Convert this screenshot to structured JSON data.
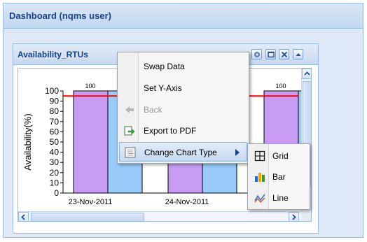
{
  "dashboard": {
    "title": "Dashboard (nqms user)"
  },
  "portlet": {
    "title": "Availability_RTUs",
    "tools": [
      "gear-icon",
      "maximize-icon",
      "close-icon",
      "collapse-icon"
    ]
  },
  "chart_data": {
    "type": "bar",
    "ylabel": "Availability(%)",
    "ylim": [
      0,
      100
    ],
    "yticks": [
      "0",
      "10",
      "20",
      "30",
      "40",
      "50",
      "60",
      "70",
      "80",
      "90",
      "100"
    ],
    "categories": [
      "23-Nov-2011",
      "24-Nov-2011"
    ],
    "visible_data_labels": [
      "100",
      "100"
    ],
    "threshold_line": 95,
    "series_colors": [
      "#c79cf2",
      "#99ccfa"
    ],
    "grid": false,
    "legend": "none"
  },
  "context_menu": {
    "items": [
      {
        "label": "Swap Data",
        "enabled": true,
        "icon": ""
      },
      {
        "label": "Set Y-Axis",
        "enabled": true,
        "icon": ""
      },
      {
        "label": "Back",
        "enabled": false,
        "icon": "back-arrow-icon"
      },
      {
        "label": "Export to PDF",
        "enabled": true,
        "icon": "export-pdf-icon"
      },
      {
        "label": "Change Chart Type",
        "enabled": true,
        "icon": "chart-type-icon",
        "has_submenu": true,
        "active": true
      }
    ]
  },
  "submenu": {
    "items": [
      {
        "label": "Grid",
        "icon": "grid-icon"
      },
      {
        "label": "Bar",
        "icon": "bar-chart-icon"
      },
      {
        "label": "Line",
        "icon": "line-chart-icon"
      }
    ]
  },
  "colors": {
    "accent": "#15428b",
    "threshold": "#ff0000"
  }
}
